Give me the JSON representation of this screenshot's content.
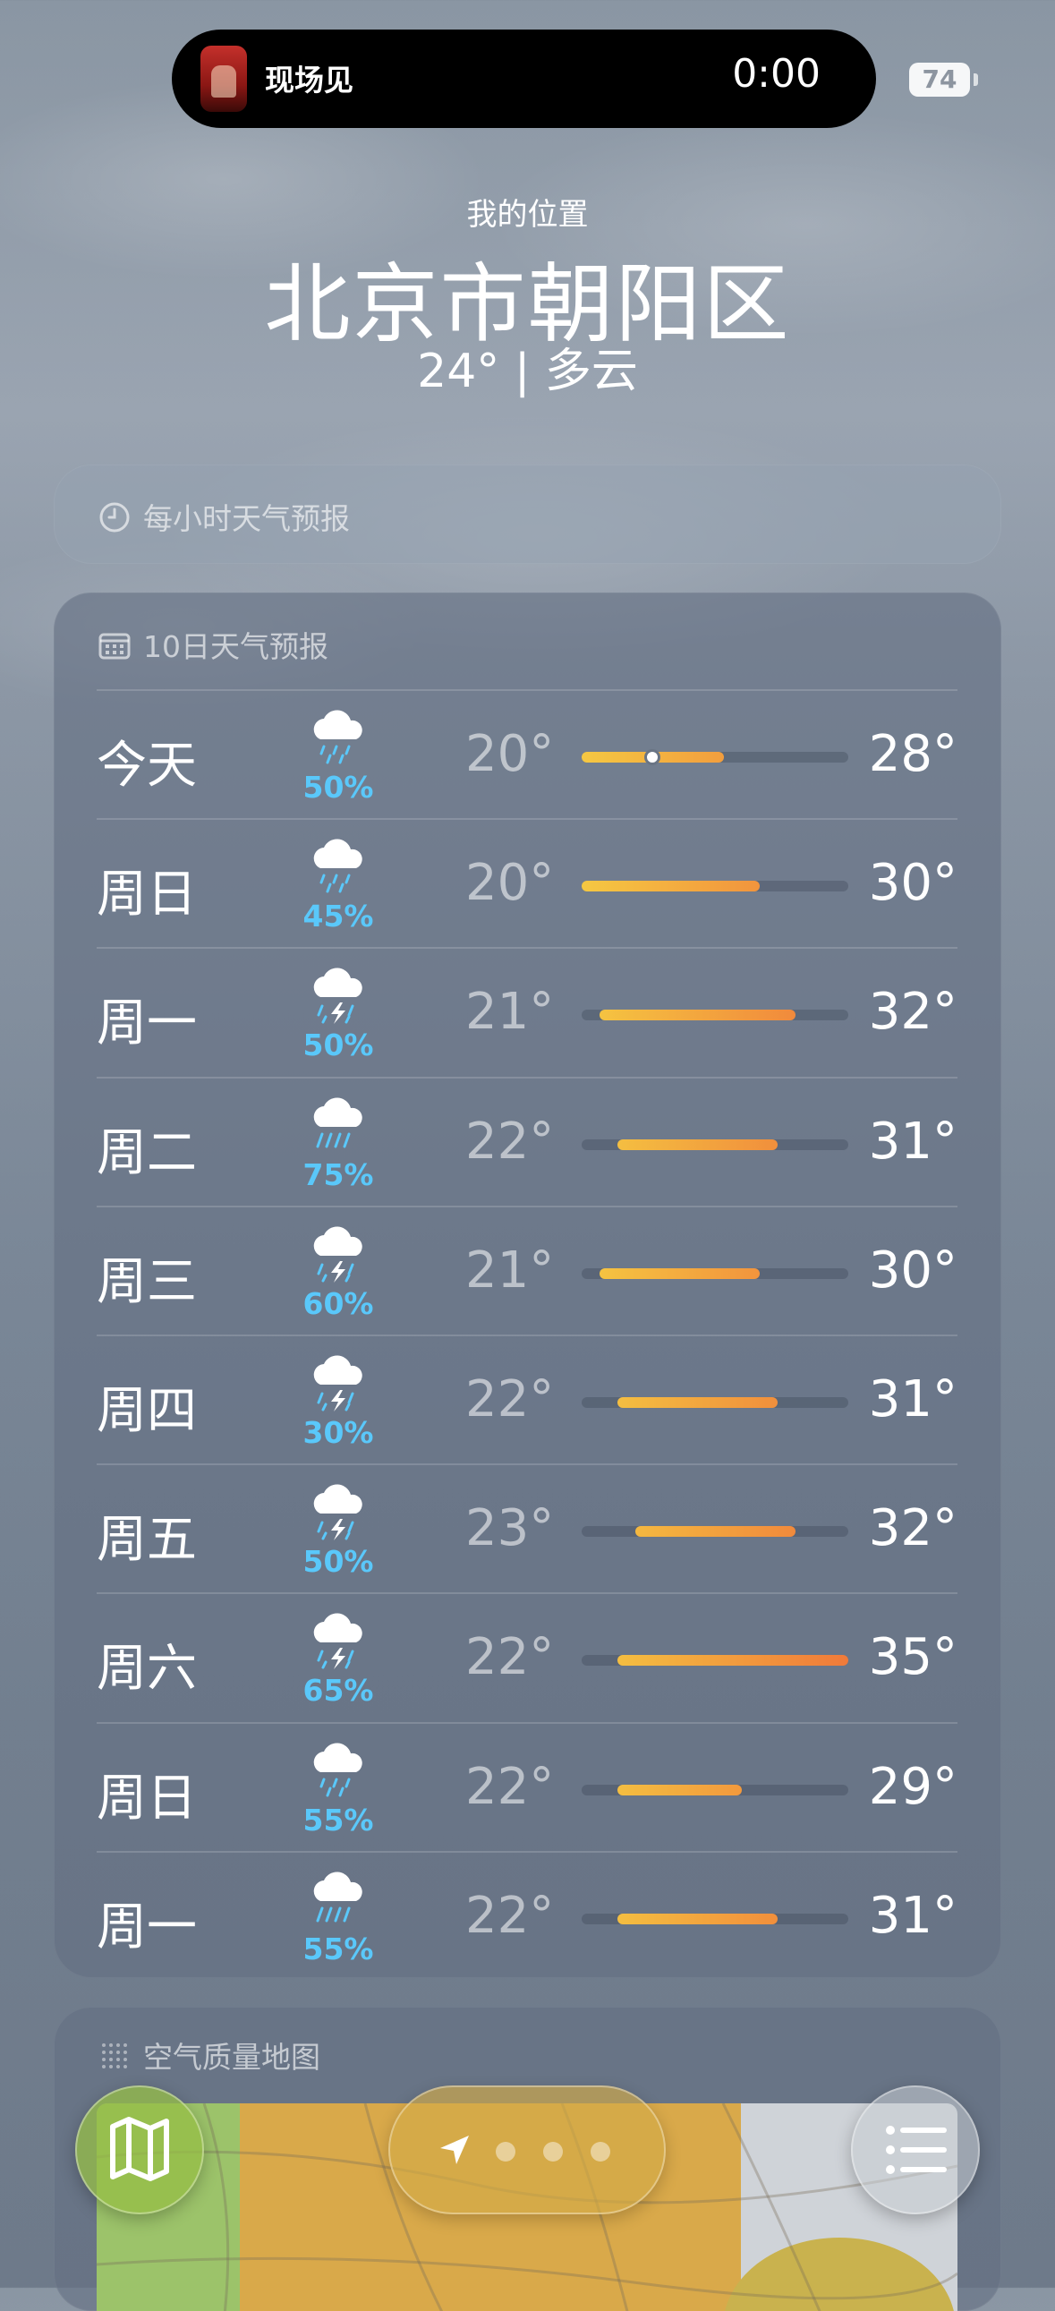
{
  "island": {
    "app_name": "现场见",
    "timer": "0:00"
  },
  "status": {
    "battery": "74"
  },
  "header": {
    "location_label": "我的位置",
    "city": "北京市朝阳区",
    "conditions": "24°  |  多云"
  },
  "hourly": {
    "title": "每小时天气预报"
  },
  "forecast": {
    "title": "10日天气预报",
    "range_min": 20,
    "range_max": 35,
    "current_temp": 24,
    "days": [
      {
        "day": "今天",
        "icon": "cloud-rain-icon",
        "precip": "50%",
        "low": "20°",
        "high": "28°",
        "low_val": 20,
        "high_val": 28,
        "current": true
      },
      {
        "day": "周日",
        "icon": "cloud-rain-icon",
        "precip": "45%",
        "low": "20°",
        "high": "30°",
        "low_val": 20,
        "high_val": 30
      },
      {
        "day": "周一",
        "icon": "cloud-bolt-rain-icon",
        "precip": "50%",
        "low": "21°",
        "high": "32°",
        "low_val": 21,
        "high_val": 32
      },
      {
        "day": "周二",
        "icon": "cloud-heavyrain-icon",
        "precip": "75%",
        "low": "22°",
        "high": "31°",
        "low_val": 22,
        "high_val": 31
      },
      {
        "day": "周三",
        "icon": "cloud-bolt-rain-icon",
        "precip": "60%",
        "low": "21°",
        "high": "30°",
        "low_val": 21,
        "high_val": 30
      },
      {
        "day": "周四",
        "icon": "cloud-bolt-rain-icon",
        "precip": "30%",
        "low": "22°",
        "high": "31°",
        "low_val": 22,
        "high_val": 31
      },
      {
        "day": "周五",
        "icon": "cloud-bolt-rain-icon",
        "precip": "50%",
        "low": "23°",
        "high": "32°",
        "low_val": 23,
        "high_val": 32
      },
      {
        "day": "周六",
        "icon": "cloud-bolt-rain-icon",
        "precip": "65%",
        "low": "22°",
        "high": "35°",
        "low_val": 22,
        "high_val": 35
      },
      {
        "day": "周日",
        "icon": "cloud-rain-icon",
        "precip": "55%",
        "low": "22°",
        "high": "29°",
        "low_val": 22,
        "high_val": 29
      },
      {
        "day": "周一",
        "icon": "cloud-heavyrain-icon",
        "precip": "55%",
        "low": "22°",
        "high": "31°",
        "low_val": 22,
        "high_val": 31
      }
    ]
  },
  "air_quality": {
    "title": "空气质量地图"
  },
  "toolbar": {
    "map_icon": "map-icon",
    "location_icon": "location-arrow-icon",
    "list_icon": "list-icon",
    "page_count": 4,
    "current_page": 1
  },
  "colors": {
    "precip": "#5ac8fa",
    "bar_cool": "#f5c842",
    "bar_hot": "#f07a3a"
  }
}
